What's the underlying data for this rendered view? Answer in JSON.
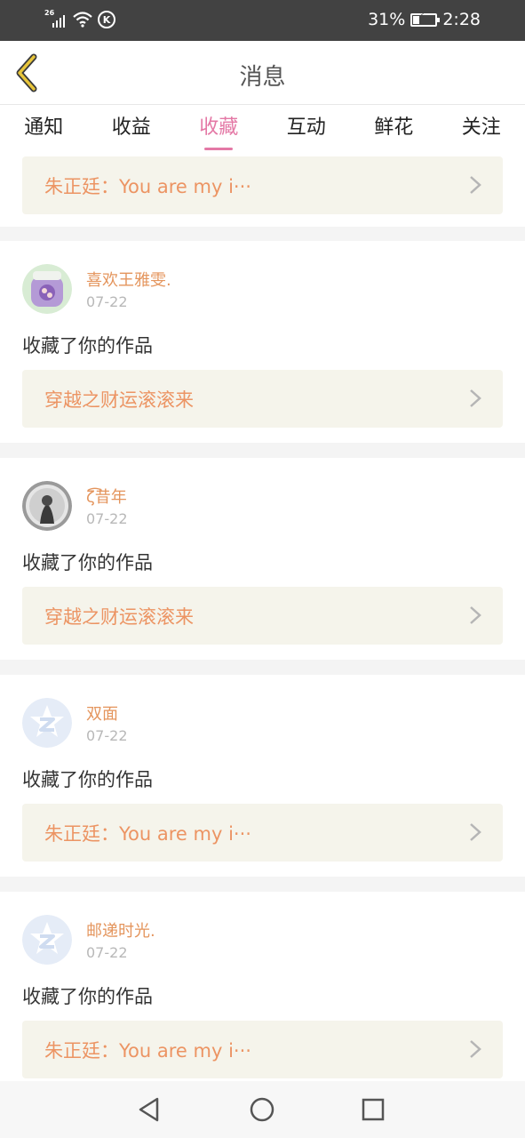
{
  "status_bar": {
    "network": "26",
    "k_icon": "K",
    "battery": "31%",
    "battery_level": 0.31,
    "time": "2:28"
  },
  "header": {
    "title": "消息"
  },
  "tabs": [
    {
      "label": "通知"
    },
    {
      "label": "收益"
    },
    {
      "label": "收藏",
      "active": true
    },
    {
      "label": "互动"
    },
    {
      "label": "鲜花"
    },
    {
      "label": "关注"
    }
  ],
  "feed": {
    "partial_top": {
      "work_title": "朱正廷：You  are  my i···"
    },
    "items": [
      {
        "user": "喜欢王雅雯.",
        "date": "07-22",
        "action": "收藏了你的作品",
        "work_title": "穿越之财运滚滚来",
        "avatar": "anime-avatar"
      },
      {
        "user": "ζ͡昔年",
        "date": "07-22",
        "action": "收藏了你的作品",
        "work_title": "穿越之财运滚滚来",
        "avatar": "photo-avatar"
      },
      {
        "user": "双面",
        "date": "07-22",
        "action": "收藏了你的作品",
        "work_title": "朱正廷：You  are  my i···",
        "avatar": "default-qq-avatar"
      },
      {
        "user": "邮递时光.",
        "date": "07-22",
        "action": "收藏了你的作品",
        "work_title": "朱正廷：You  are  my i···",
        "avatar": "default-qq-avatar"
      }
    ]
  },
  "colors": {
    "accent": "#e479a6",
    "username": "#e4955d",
    "work_title": "#ec9463",
    "work_bg": "#f5f4eb",
    "status_bar_bg": "#424242",
    "back_arrow": "#e8c53a"
  },
  "icons": {
    "back": "chevron-left-icon",
    "signal": "signal-icon",
    "wifi": "wifi-icon",
    "battery": "battery-charging-icon",
    "nav_back": "triangle-back-icon",
    "nav_home": "circle-home-icon",
    "nav_recents": "square-recents-icon"
  }
}
